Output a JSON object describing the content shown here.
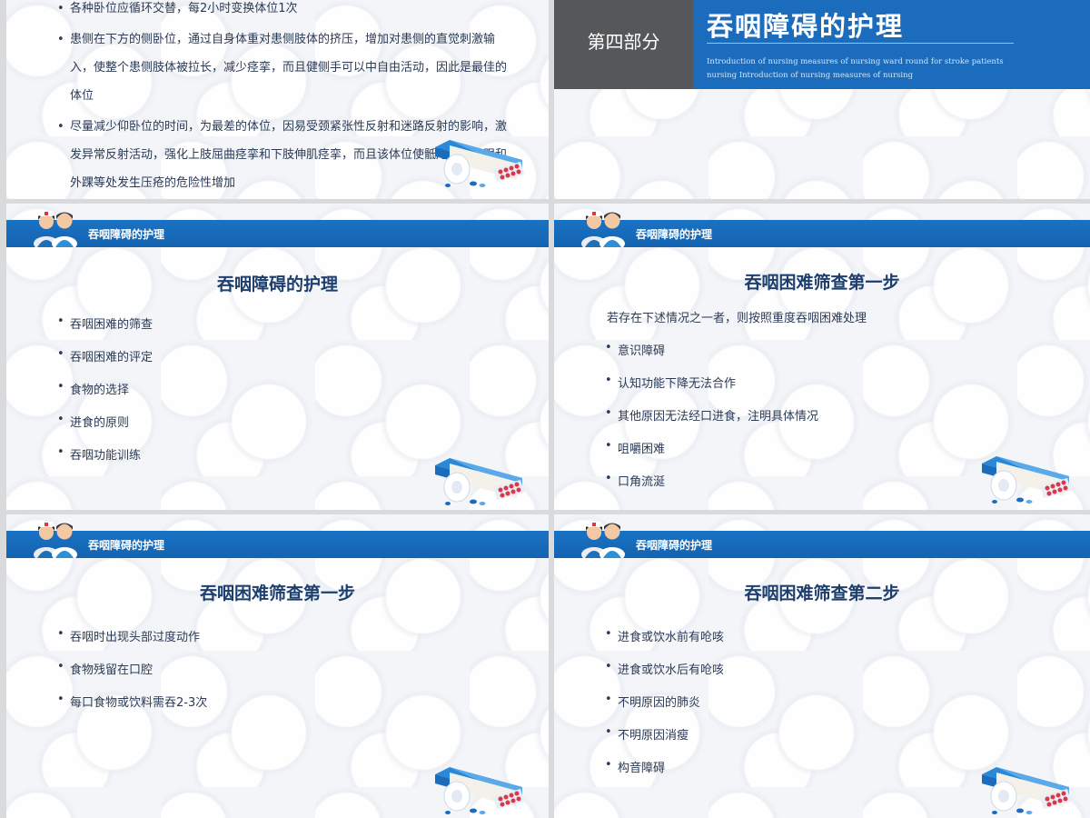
{
  "slide1": {
    "items": [
      "各种卧位应循环交替，每2小时变换体位1次",
      "患侧在下方的侧卧位，通过自身体重对患侧肢体的挤压，增加对患侧的直觉刺激输入，使整个患侧肢体被拉长，减少痉挛，而且健侧手可以中自由活动，因此是最佳的体位",
      "尽量减少仰卧位的时间，为最差的体位，因易受颈紧张性反射和迷路反射的影响，激发异常反射活动，强化上肢屈曲痉挛和下肢伸肌痉挛，而且该体位使骶尾部、足跟和外踝等处发生压疮的危险性增加"
    ]
  },
  "slide2": {
    "section_label": "第四部分",
    "title": "吞咽障碍的护理",
    "subtitle": "Introduction of nursing measures of nursing ward round for stroke patients nursing Introduction of nursing measures of nursing"
  },
  "header_band_title": "吞咽障碍的护理",
  "slide3": {
    "title": "吞咽障碍的护理",
    "items": [
      "吞咽困难的筛查",
      "吞咽困难的评定",
      "食物的选择",
      "进食的原则",
      "吞咽功能训练"
    ]
  },
  "slide4": {
    "title": "吞咽困难筛查第一步",
    "intro": "若存在下述情况之一者，则按照重度吞咽困难处理",
    "items": [
      "意识障碍",
      "认知功能下降无法合作",
      "其他原因无法经口进食，注明具体情况",
      "咀嚼困难",
      "口角流涎"
    ]
  },
  "slide5": {
    "title": "吞咽困难筛查第一步",
    "items": [
      "吞咽时出现头部过度动作",
      "食物残留在口腔",
      "每口食物或饮料需吞2-3次"
    ]
  },
  "slide6": {
    "title": "吞咽困难筛查第二步",
    "items": [
      "进食或饮水前有呛咳",
      "进食或饮水后有呛咳",
      "不明原因的肺炎",
      "不明原因消瘦",
      "构音障碍"
    ]
  },
  "colors": {
    "band": "#1463b0",
    "title": "#1e3f6e",
    "section_gray": "#555759",
    "section_blue": "#1c6cbd"
  },
  "icons": [
    "doctor-nurse-avatar-icon",
    "medicine-box-icon"
  ]
}
